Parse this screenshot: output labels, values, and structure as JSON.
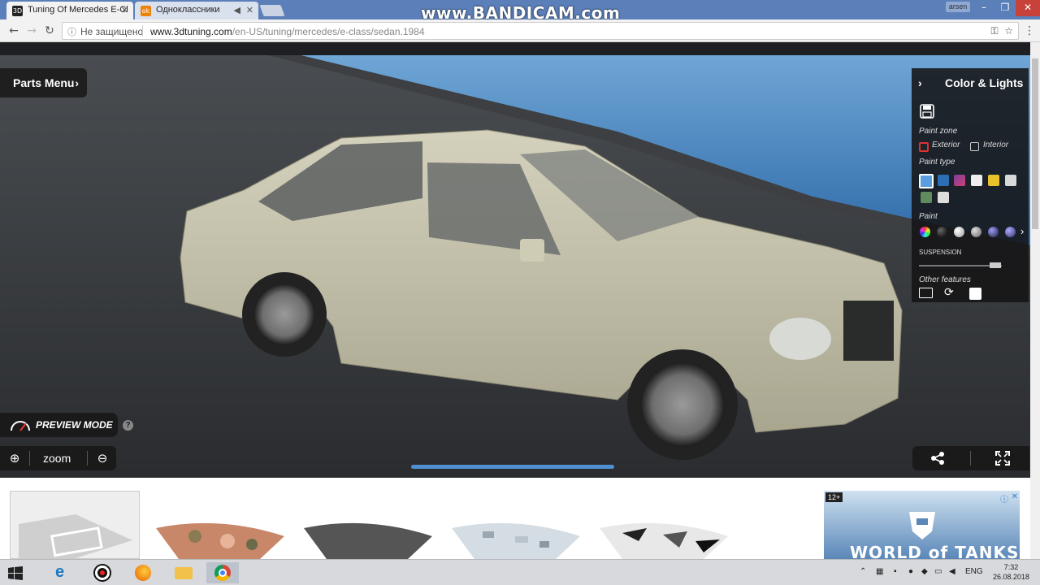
{
  "browser": {
    "tabs": [
      {
        "label": "Tuning Of Mercedes E-Cl",
        "favicon": "3dt"
      },
      {
        "label": "Одноклассники",
        "favicon": "ok"
      }
    ],
    "watermark": "www.BANDICAM.com",
    "user": "arsen",
    "address": {
      "security_label": "Не защищено",
      "url_host": "www.3dtuning.com",
      "url_path": "/en-US/tuning/mercedes/e-class/sedan.1984"
    }
  },
  "viewer": {
    "parts_menu_label": "Parts Menu",
    "panel": {
      "title": "Color & Lights",
      "paint_zone_label": "Paint zone",
      "zone_options": [
        "Exterior",
        "Interior"
      ],
      "paint_type_label": "Paint type",
      "paint_label": "Paint",
      "suspension_label": "SUSPENSION",
      "other_features_label": "Other features"
    },
    "preview_mode_label": "PREVIEW MODE",
    "help_glyph": "?",
    "zoom_label": "zoom",
    "loading_progress": 1.0,
    "car_color": "#c9c6b0"
  },
  "bottom": {
    "ad_age": "12+",
    "ad_brand": "WORLD of TANKS"
  },
  "taskbar": {
    "language": "ENG",
    "time": "7:32",
    "date": "26.08.2018"
  }
}
